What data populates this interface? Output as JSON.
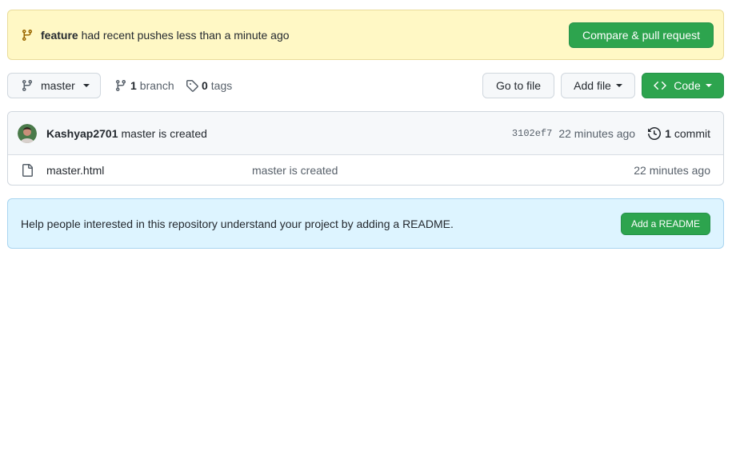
{
  "banner": {
    "branch_name": "feature",
    "message": "had recent pushes less than a minute ago",
    "compare_button": "Compare & pull request"
  },
  "toolbar": {
    "branch_select_label": "master",
    "branch_count": "1",
    "branch_label": "branch",
    "tag_count": "0",
    "tag_label": "tags",
    "go_to_file": "Go to file",
    "add_file": "Add file",
    "code": "Code"
  },
  "commit": {
    "author": "Kashyap2701",
    "message": "master is created",
    "sha": "3102ef7",
    "time": "22 minutes ago",
    "count": "1",
    "count_label": "commit"
  },
  "files": [
    {
      "name": "master.html",
      "message": "master is created",
      "age": "22 minutes ago"
    }
  ],
  "readme": {
    "message": "Help people interested in this repository understand your project by adding a README.",
    "button": "Add a README"
  },
  "colors": {
    "primary_green": "#2da44e",
    "banner_bg": "#fff8c5",
    "readme_bg": "#ddf4ff",
    "banner_icon": "#9a6700"
  },
  "icons": [
    "git-branch-icon",
    "tag-icon",
    "code-icon",
    "history-icon",
    "file-icon",
    "avatar"
  ]
}
